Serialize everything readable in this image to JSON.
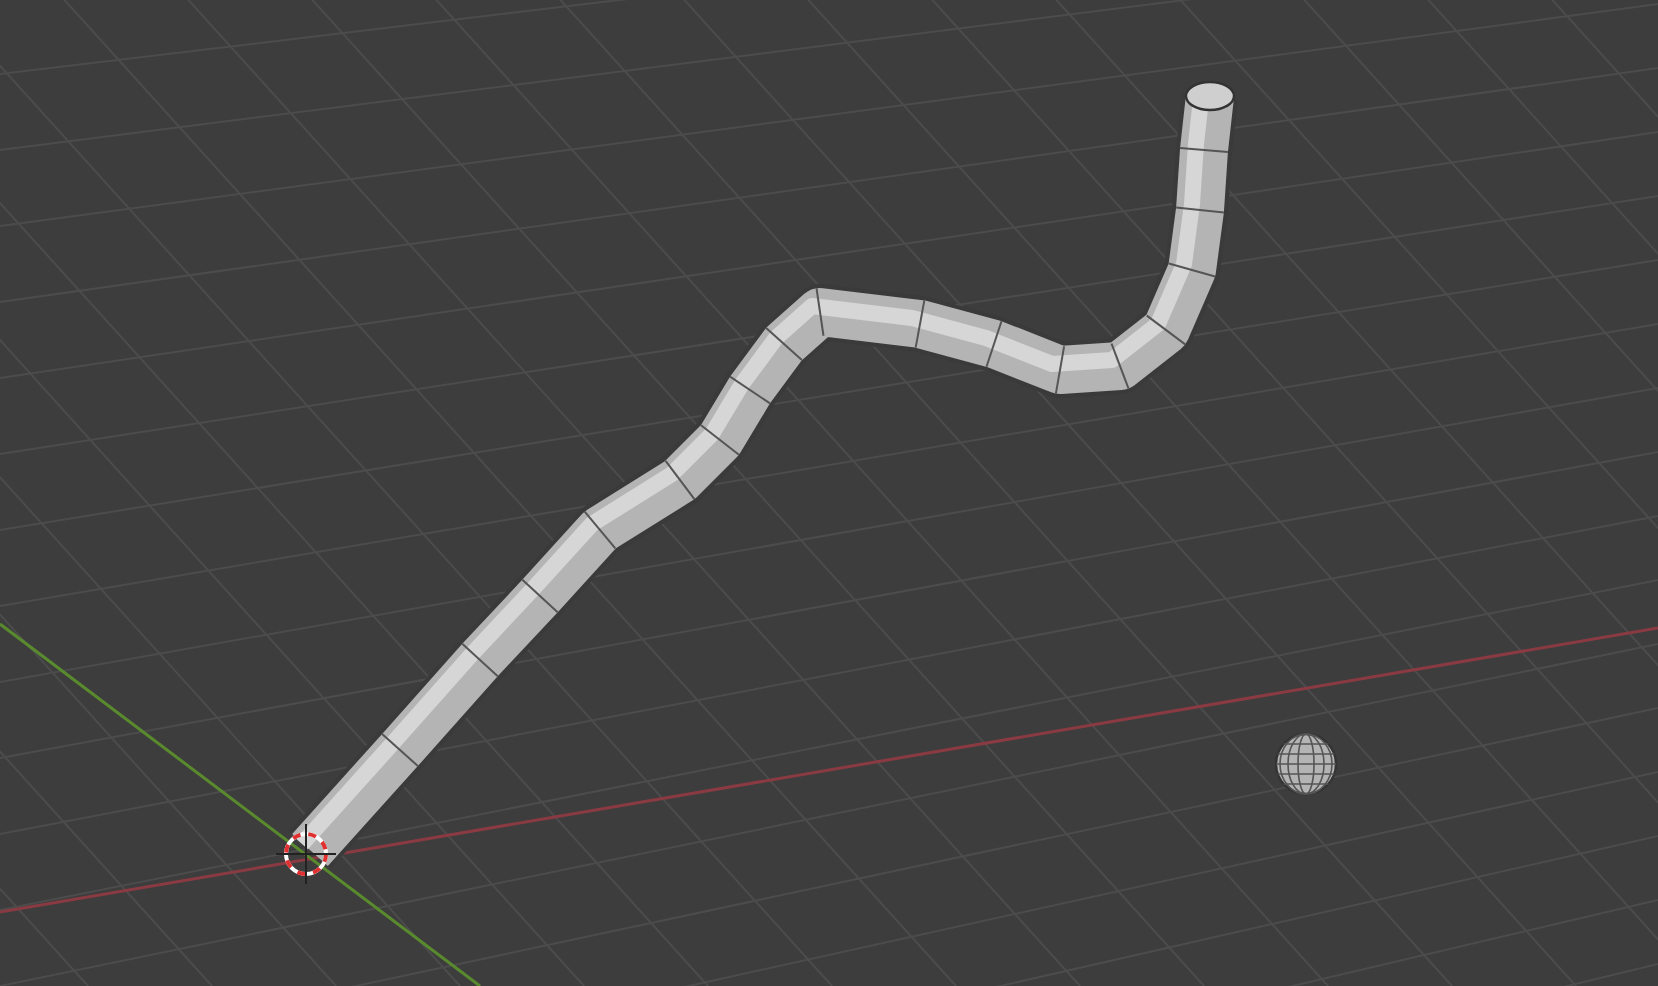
{
  "viewport": {
    "axes": [
      {
        "kind": "x"
      },
      {
        "kind": "y"
      }
    ],
    "objects": [
      {
        "kind": "tube"
      },
      {
        "kind": "sphere"
      },
      {
        "kind": "cursor"
      }
    ]
  }
}
